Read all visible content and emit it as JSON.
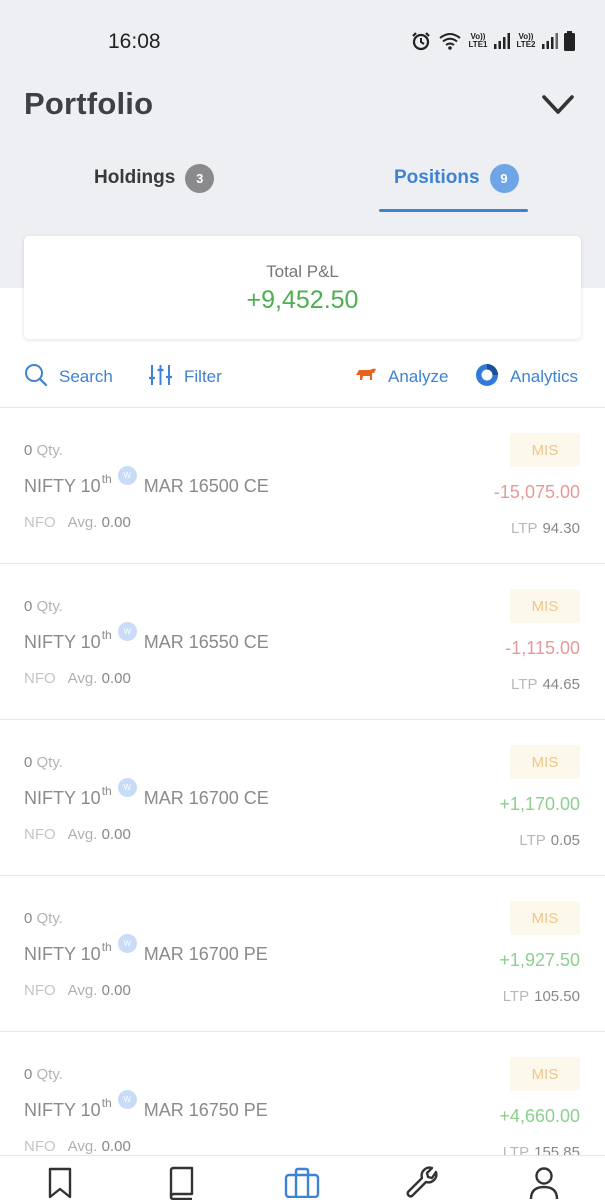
{
  "status_bar": {
    "time": "16:08",
    "sim1_label": "Vo)) LTE1",
    "sim2_label": "Vo)) LTE2"
  },
  "header": {
    "title": "Portfolio"
  },
  "tabs": [
    {
      "label": "Holdings",
      "count": "3",
      "active": false
    },
    {
      "label": "Positions",
      "count": "9",
      "active": true
    }
  ],
  "pnl": {
    "label": "Total P&L",
    "value": "+9,452.50"
  },
  "toolbar": {
    "search": "Search",
    "filter": "Filter",
    "analyze": "Analyze",
    "analytics": "Analytics"
  },
  "positions": [
    {
      "qty": "0",
      "qty_label": "Qty.",
      "symbol": "NIFTY 10",
      "sup": "th",
      "weekly": "W",
      "contract": "MAR 16500 CE",
      "exchange": "NFO",
      "avg_label": "Avg.",
      "avg": "0.00",
      "product": "MIS",
      "pnl": "-15,075.00",
      "ltp_label": "LTP",
      "ltp": "94.30"
    },
    {
      "qty": "0",
      "qty_label": "Qty.",
      "symbol": "NIFTY 10",
      "sup": "th",
      "weekly": "W",
      "contract": "MAR 16550 CE",
      "exchange": "NFO",
      "avg_label": "Avg.",
      "avg": "0.00",
      "product": "MIS",
      "pnl": "-1,115.00",
      "ltp_label": "LTP",
      "ltp": "44.65"
    },
    {
      "qty": "0",
      "qty_label": "Qty.",
      "symbol": "NIFTY 10",
      "sup": "th",
      "weekly": "W",
      "contract": "MAR 16700 CE",
      "exchange": "NFO",
      "avg_label": "Avg.",
      "avg": "0.00",
      "product": "MIS",
      "pnl": "+1,170.00",
      "ltp_label": "LTP",
      "ltp": "0.05"
    },
    {
      "qty": "0",
      "qty_label": "Qty.",
      "symbol": "NIFTY 10",
      "sup": "th",
      "weekly": "W",
      "contract": "MAR 16700 PE",
      "exchange": "NFO",
      "avg_label": "Avg.",
      "avg": "0.00",
      "product": "MIS",
      "pnl": "+1,927.50",
      "ltp_label": "LTP",
      "ltp": "105.50"
    },
    {
      "qty": "0",
      "qty_label": "Qty.",
      "symbol": "NIFTY 10",
      "sup": "th",
      "weekly": "W",
      "contract": "MAR 16750 PE",
      "exchange": "NFO",
      "avg_label": "Avg.",
      "avg": "0.00",
      "product": "MIS",
      "pnl": "+4,660.00",
      "ltp_label": "LTP",
      "ltp": "155.85"
    }
  ],
  "bottom_nav": [
    {
      "icon": "bookmark-icon",
      "label": "Watchlist"
    },
    {
      "icon": "book-icon",
      "label": "Orders"
    },
    {
      "icon": "briefcase-icon",
      "label": "Portfolio",
      "active": true
    },
    {
      "icon": "wrench-icon",
      "label": "Tools"
    },
    {
      "icon": "user-icon",
      "label": "Profile"
    }
  ],
  "colors": {
    "accent": "#3d83d5",
    "profit": "#4caf50",
    "loss": "#e59a9a",
    "mis_text": "#f1c58a",
    "header_bg": "#eeeff2"
  }
}
